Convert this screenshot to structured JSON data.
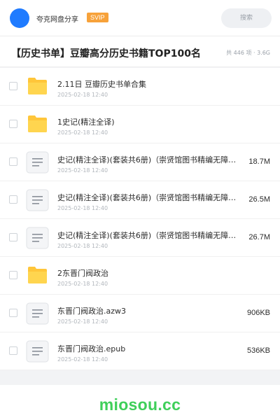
{
  "topbar": {
    "username": "夸克网盘分享",
    "badge": "SVIP",
    "search_placeholder": "搜索",
    "accent_color": "#1f7bff",
    "badge_color": "#f7a23a"
  },
  "share": {
    "title": "【历史书单】豆瓣高分历史书籍TOP100名",
    "meta": "共 446 项 · 3.6G"
  },
  "files": [
    {
      "type": "folder",
      "icon": "folder-icon",
      "name": "2.11日 豆瓣历史书单合集",
      "date": "2025-02-18 12:40",
      "size": ""
    },
    {
      "type": "folder",
      "icon": "folder-icon",
      "name": "1史记(精注全译)",
      "date": "2025-02-18 12:40",
      "size": ""
    },
    {
      "type": "file",
      "icon": "document-icon",
      "name": "史记(精注全译)(套装共6册)（崇贤馆图书精编无障…",
      "date": "2025-02-18 12:40",
      "size": "18.7M"
    },
    {
      "type": "file",
      "icon": "document-icon",
      "name": "史记(精注全译)(套装共6册)（崇贤馆图书精编无障…",
      "date": "2025-02-18 12:40",
      "size": "26.5M"
    },
    {
      "type": "file",
      "icon": "document-icon",
      "name": "史记(精注全译)(套装共6册)（崇贤馆图书精编无障…",
      "date": "2025-02-18 12:40",
      "size": "26.7M"
    },
    {
      "type": "folder",
      "icon": "folder-icon",
      "name": "2东晋门阀政治",
      "date": "2025-02-18 12:40",
      "size": ""
    },
    {
      "type": "file",
      "icon": "document-icon",
      "name": "东晋门阀政治.azw3",
      "date": "2025-02-18 12:40",
      "size": "906KB"
    },
    {
      "type": "file",
      "icon": "document-icon",
      "name": "东晋门阀政治.epub",
      "date": "2025-02-18 12:40",
      "size": "536KB"
    }
  ],
  "footer": {
    "watermark": "miosou.cc",
    "watermark_color": "#3fcf5a"
  }
}
